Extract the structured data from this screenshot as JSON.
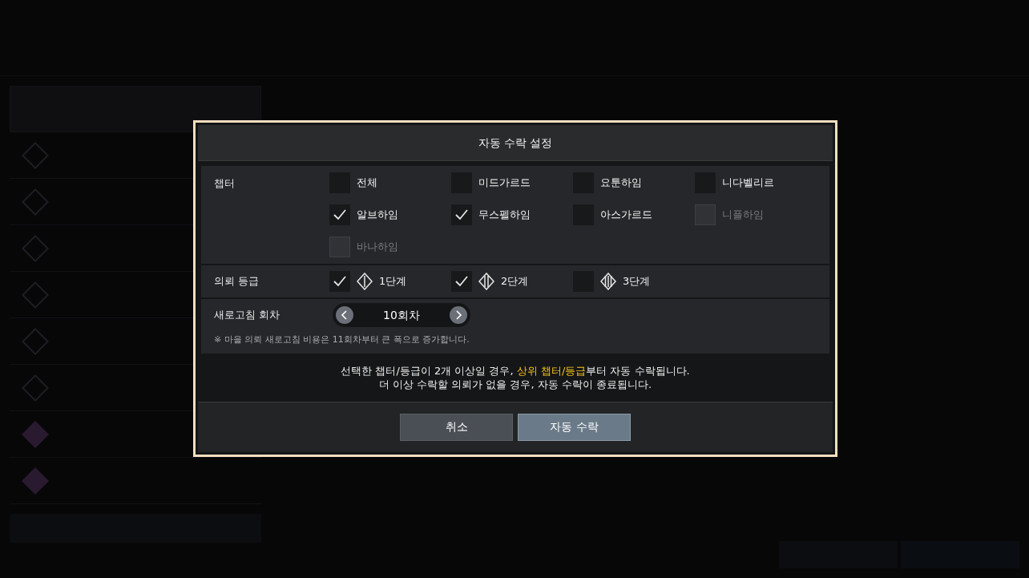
{
  "dialog": {
    "title": "자동 수락 설정",
    "chapter": {
      "label": "챕터",
      "options": [
        {
          "label": "전체",
          "checked": false,
          "disabled": false
        },
        {
          "label": "미드가르드",
          "checked": false,
          "disabled": false
        },
        {
          "label": "요툰하임",
          "checked": false,
          "disabled": false
        },
        {
          "label": "니다벨리르",
          "checked": false,
          "disabled": false
        },
        {
          "label": "알브하임",
          "checked": true,
          "disabled": false
        },
        {
          "label": "무스펠하임",
          "checked": true,
          "disabled": false
        },
        {
          "label": "아스가르드",
          "checked": false,
          "disabled": false
        },
        {
          "label": "니플하임",
          "checked": false,
          "disabled": true
        },
        {
          "label": "바나하임",
          "checked": false,
          "disabled": true
        }
      ]
    },
    "grade": {
      "label": "의뢰 등급",
      "options": [
        {
          "label": "1단계",
          "checked": true
        },
        {
          "label": "2단계",
          "checked": true
        },
        {
          "label": "3단계",
          "checked": false
        }
      ]
    },
    "refresh": {
      "label": "새로고침 회차",
      "value": "10회차",
      "note": "※ 마을 의뢰 새로고침 비용은 11회차부터 큰 폭으로 증가합니다."
    },
    "message": [
      "선택한 챕터/등급이 2개 이상일 경우, ",
      "상위 챕터/등급",
      "부터 자동 수락됩니다."
    ],
    "message_line2": "더 이상 수락할 의뢰가 없을 경우, 자동 수락이 종료됩니다.",
    "buttons": [
      {
        "label": "취소",
        "kind": "cancel"
      },
      {
        "label": "자동 수락",
        "kind": "confirm"
      }
    ]
  }
}
